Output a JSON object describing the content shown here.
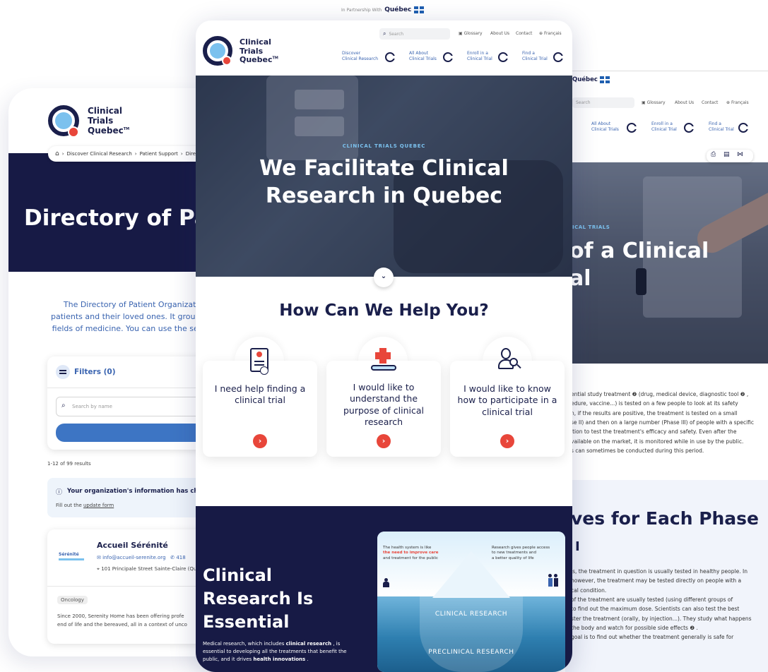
{
  "partnership": {
    "label": "In Partnership With",
    "brand": "Québec"
  },
  "logo": {
    "line1": "Clinical",
    "line2": "Trials",
    "line3": "Quebec",
    "tm": "TM"
  },
  "search": {
    "placeholder": "Search"
  },
  "util_links": {
    "glossary": "Glossary",
    "about": "About Us",
    "contact": "Contact",
    "lang": "Français"
  },
  "nav": [
    {
      "line1": "Discover",
      "line2": "Clinical Research"
    },
    {
      "line1": "All About",
      "line2": "Clinical Trials"
    },
    {
      "line1": "Enroll in a",
      "line2": "Clinical Trial"
    },
    {
      "line1": "Find a",
      "line2": "Clinical Trial"
    }
  ],
  "hero": {
    "kicker": "CLINICAL TRIALS QUEBEC",
    "title_line1": "We Facilitate Clinical",
    "title_line2": "Research in Quebec"
  },
  "help": {
    "title": "How Can We Help You?",
    "cards": [
      {
        "text": "I need help finding a clinical trial"
      },
      {
        "text": "I would like to understand the purpose of clinical research"
      },
      {
        "text": "I would like to know how to participate in a clinical trial"
      }
    ]
  },
  "essential": {
    "title_line1": "Clinical",
    "title_line2": "Research Is",
    "title_line3": "Essential",
    "body_pre": "Medical research, which includes ",
    "body_b1": "clinical research",
    "body_mid": " , is essential to developing all the treatments that benefit the public, and it drives ",
    "body_b2": "health innovations",
    "body_post": " ."
  },
  "iceberg": {
    "note_left_1": "The health system is like",
    "note_left_2": "the need to improve care",
    "note_left_3": "and treatment for the public",
    "note_right_1": "Research gives people access",
    "note_right_2": "to new treatments and",
    "note_right_3": "a better quality of life",
    "label_top": "CLINICAL RESEARCH",
    "label_bottom": "PRECLINICAL RESEARCH"
  },
  "left_page": {
    "breadcrumb": [
      "Discover Clinical Research",
      "Patient Support",
      "Directory"
    ],
    "title": "Directory of Pa",
    "intro_1": "The Directory of Patient Organizatio",
    "intro_2": "patients and their loved ones. It groups",
    "intro_3": "fields of medicine. You can use the sea",
    "filters": "Filters (0)",
    "search_placeholder": "Search by name",
    "results": "1-12 of 99 results",
    "notice": "Your organization's information has cha",
    "notice_link_pre": "Fill out the ",
    "notice_link": "update form",
    "org_name": "Accueil Sérénité",
    "org_email": "info@accueil-serenite.org",
    "org_phone": "418",
    "org_address": "101 Principale Street Sainte-Claire (Qu",
    "org_logo_text": "Sérénité",
    "org_tag": "Oncology",
    "org_desc_1": "Since 2000, Serenity Home has been offering profe",
    "org_desc_2": "end of life and the bereaved, all in a context of unco"
  },
  "right_page": {
    "brand": "Québec",
    "nav": [
      {
        "line1": "All About",
        "line2": "Clinical Trials"
      },
      {
        "line1": "Enroll in a",
        "line2": "Clinical Trial"
      },
      {
        "line1": "Find a",
        "line2": "Clinical Trial"
      }
    ],
    "kicker": "ICAL TRIALS",
    "title_1": "of a Clinical",
    "title_2": "al",
    "body": [
      "ential study treatment ❷ (drug, medical device, diagnostic tool ❷ ,",
      "edure, vaccine...) is tested on a few people to look at its safety",
      "n, if the results are positive, the treatment is tested on a small",
      "se II) and then on a large number (Phase III) of people with a specific",
      "ition to test the treatment's efficacy and safety. Even after the",
      "vailable on the market, it is monitored while in use by the public.",
      "s can sometimes be conducted during this period."
    ],
    "section_title": "ves for Each Phase",
    "phase": "I",
    "body2": [
      "is, the treatment in question is usually tested in healthy people. In",
      "however, the treatment may be tested directly on people with a",
      "cal condition.",
      "",
      "of the treatment are usually tested (using different groups of",
      "to find out the maximum dose. Scientists can also test the best",
      "ster the treatment (orally, by injection...). They study what happens",
      "the body and watch for possible side effects ❷ .",
      "",
      "goal is to find out whether the treatment generally is safe for"
    ]
  }
}
